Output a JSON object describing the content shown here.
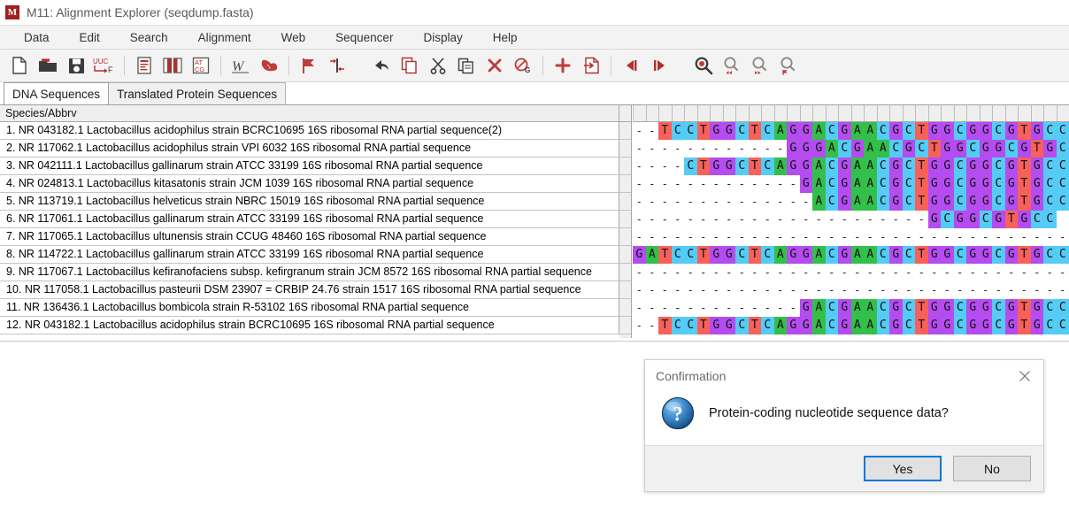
{
  "window": {
    "icon": "mega-app-icon",
    "title": "M11: Alignment Explorer (seqdump.fasta)"
  },
  "menubar": {
    "items": [
      {
        "label": "Data"
      },
      {
        "label": "Edit"
      },
      {
        "label": "Search"
      },
      {
        "label": "Alignment"
      },
      {
        "label": "Web"
      },
      {
        "label": "Sequencer"
      },
      {
        "label": "Display"
      },
      {
        "label": "Help"
      }
    ]
  },
  "toolbar": {
    "groups": [
      {
        "buttons": [
          {
            "icon": "new-file-icon",
            "tooltip": "Create New"
          },
          {
            "icon": "open-folder-icon",
            "tooltip": "Open Session"
          },
          {
            "icon": "save-disk-icon",
            "tooltip": "Save Session"
          },
          {
            "icon": "translate-uuc-f-icon",
            "tooltip": "Translate/Untranslate"
          }
        ]
      },
      {
        "buttons": [
          {
            "icon": "edit-sequencer-icon",
            "tooltip": "Edit Sequencer Files"
          },
          {
            "icon": "split-panes-icon",
            "tooltip": "Display Two Panes"
          },
          {
            "icon": "atcg-box-icon",
            "tooltip": "Display Codon Positions"
          }
        ]
      },
      {
        "buttons": [
          {
            "icon": "clustalw-w-icon",
            "tooltip": "Align by ClustalW"
          },
          {
            "icon": "muscle-arm-icon",
            "tooltip": "Align by MUSCLE"
          }
        ]
      },
      {
        "buttons": [
          {
            "icon": "red-flag-icon",
            "tooltip": "Mark Site"
          },
          {
            "icon": "align-marker-icon",
            "tooltip": "Align Marked Sites"
          }
        ]
      },
      {
        "buttons": [
          {
            "icon": "undo-arrow-icon",
            "tooltip": "Undo"
          },
          {
            "icon": "copy-icon",
            "tooltip": "Copy"
          },
          {
            "icon": "cut-scissors-icon",
            "tooltip": "Cut"
          },
          {
            "icon": "paste-icon",
            "tooltip": "Paste"
          },
          {
            "icon": "delete-x-icon",
            "tooltip": "Delete"
          },
          {
            "icon": "delete-gaps-icon",
            "tooltip": "Delete Gaps"
          }
        ]
      },
      {
        "buttons": [
          {
            "icon": "insert-plus-icon",
            "tooltip": "Insert Blank Sequence"
          },
          {
            "icon": "insert-from-file-icon",
            "tooltip": "Add Sequence From File"
          }
        ]
      },
      {
        "buttons": [
          {
            "icon": "step-left-icon",
            "tooltip": "Move Left"
          },
          {
            "icon": "step-right-icon",
            "tooltip": "Move Right"
          }
        ]
      },
      {
        "buttons": [
          {
            "icon": "find-icon",
            "tooltip": "Find Motif"
          },
          {
            "icon": "find-previous-icon",
            "tooltip": "Find Previous"
          },
          {
            "icon": "find-next-icon",
            "tooltip": "Find Next"
          },
          {
            "icon": "find-marked-icon",
            "tooltip": "Find Next Marked Site"
          }
        ]
      }
    ]
  },
  "tabs": [
    {
      "label": "DNA Sequences",
      "active": true
    },
    {
      "label": "Translated Protein Sequences",
      "active": false
    }
  ],
  "grid": {
    "column_header": "Species/Abbrv",
    "rows": [
      {
        "n": 1,
        "label": "1. NR 043182.1 Lactobacillus acidophilus strain BCRC10695 16S ribosomal RNA partial sequence(2)"
      },
      {
        "n": 2,
        "label": "2. NR 117062.1 Lactobacillus acidophilus strain VPI 6032 16S ribosomal RNA partial sequence"
      },
      {
        "n": 3,
        "label": "3. NR 042111.1 Lactobacillus gallinarum strain ATCC 33199 16S ribosomal RNA partial sequence"
      },
      {
        "n": 4,
        "label": "4. NR 024813.1 Lactobacillus kitasatonis strain JCM 1039 16S ribosomal RNA partial sequence"
      },
      {
        "n": 5,
        "label": "5. NR 113719.1 Lactobacillus helveticus strain NBRC 15019 16S ribosomal RNA partial sequence"
      },
      {
        "n": 6,
        "label": "6. NR 117061.1 Lactobacillus gallinarum strain ATCC 33199 16S ribosomal RNA partial sequence"
      },
      {
        "n": 7,
        "label": "7. NR 117065.1 Lactobacillus ultunensis strain CCUG 48460 16S ribosomal RNA partial sequence"
      },
      {
        "n": 8,
        "label": "8. NR 114722.1 Lactobacillus gallinarum strain ATCC 33199 16S ribosomal RNA partial sequence"
      },
      {
        "n": 9,
        "label": "9. NR 117067.1 Lactobacillus kefiranofaciens subsp. kefirgranum strain JCM 8572 16S ribosomal RNA partial sequence"
      },
      {
        "n": 10,
        "label": "10. NR 117058.1 Lactobacillus pasteurii DSM 23907 = CRBIP 24.76 strain 1517 16S ribosomal RNA partial sequence"
      },
      {
        "n": 11,
        "label": "11. NR 136436.1 Lactobacillus bombicola strain R-53102 16S ribosomal RNA partial sequence"
      },
      {
        "n": 12,
        "label": "12. NR 043182.1 Lactobacillus acidophilus strain BCRC10695 16S ribosomal RNA partial sequence"
      }
    ],
    "sequences": [
      "--TCCTGGCTCAGGACGAACGCTGGCGGCGTGCC",
      "------------GGGACGAACGCTGGCGGCGTGCC",
      "----CTGGCTCAGGACGAACGCTGGCGGCGTGCC",
      "-------------GACGAACGCTGGCGGCGTGCC",
      "--------------ACGAACGCTGGCGGCGTGCC",
      "-----------------------GCGGCGTGCC",
      "----------------------------------",
      "GATCCTGGCTCAGGACGAACGCTGGCGGCGTGCC",
      "----------------------------------",
      "----------------------------------",
      "-------------GACGAACGCTGGCGGCGTGCC",
      "--TCCTGGCTCAGGACGAACGCTGGCGGCGTGCC"
    ],
    "nucleotide_colors": {
      "A": "#33c04a",
      "T": "#f8605a",
      "C": "#55ccf5",
      "G": "#b44cf0",
      "gap": "#ffffff"
    }
  },
  "dialog": {
    "title": "Confirmation",
    "close_icon": "close-icon",
    "icon": "question-mark-icon",
    "message": "Protein-coding nucleotide sequence data?",
    "buttons": [
      {
        "label": "Yes",
        "primary": true
      },
      {
        "label": "No",
        "primary": false
      }
    ]
  },
  "theme": {
    "accent": "#0078d7",
    "brand_red": "#a02020",
    "toolbar_bg": "#f3f3f3"
  }
}
